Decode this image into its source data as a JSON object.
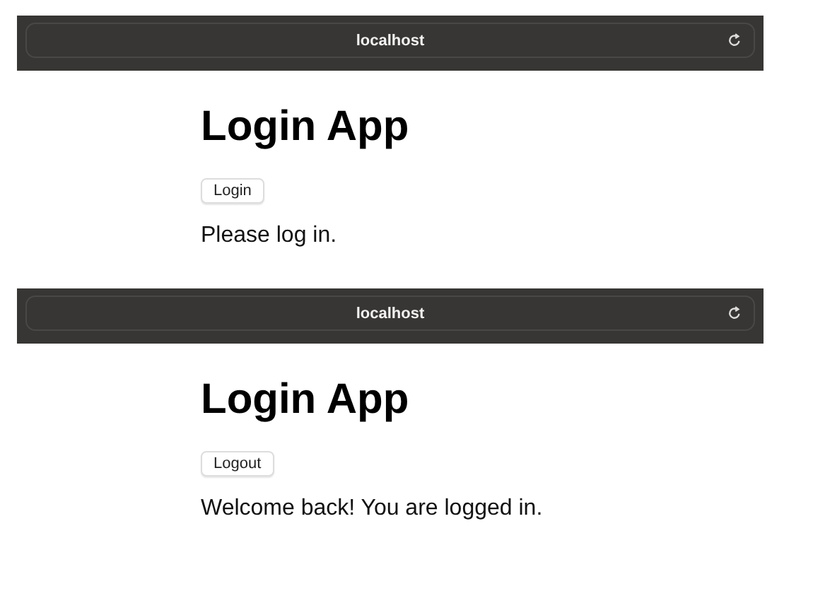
{
  "panels": [
    {
      "address": "localhost",
      "title": "Login App",
      "button": "Login",
      "message": "Please log in."
    },
    {
      "address": "localhost",
      "title": "Login App",
      "button": "Logout",
      "message": "Welcome back! You are logged in."
    }
  ]
}
